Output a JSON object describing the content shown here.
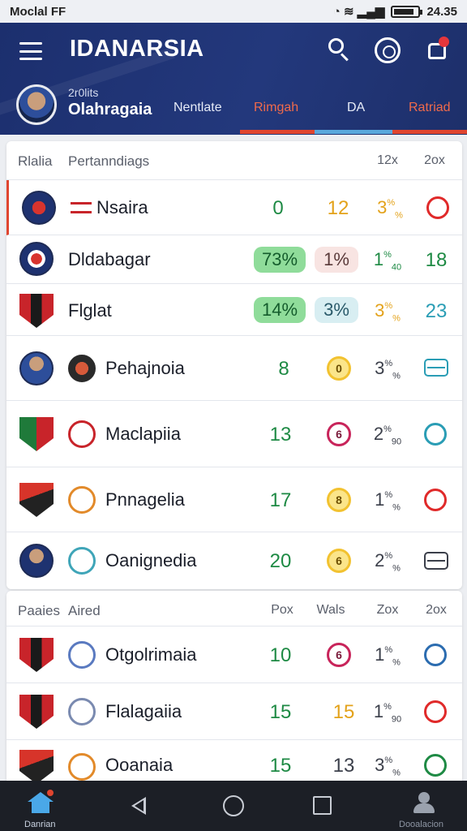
{
  "status_bar": {
    "left_text": "Moclal FF",
    "time": "24.35"
  },
  "header": {
    "app_title": "IDANARSIA",
    "league_label_small": "2r0lits",
    "league_name": "Olahragaia",
    "tabs": [
      {
        "label": "Nentlate",
        "active": false
      },
      {
        "label": "Rimgah",
        "active": true
      },
      {
        "label": "DA",
        "active": false
      },
      {
        "label": "Ratriad",
        "active": false
      }
    ],
    "colors": {
      "primary": "#1c2f6e",
      "accent_red": "#e0452f",
      "accent_blue": "#5aa8dc"
    }
  },
  "section1": {
    "header": {
      "left": "Rlalia",
      "title": "Pertanndiags",
      "col3": "12x",
      "col4": "2ox"
    },
    "rows": [
      {
        "name": "Nsaira",
        "v1": "0",
        "v2": "12",
        "v3_main": "3",
        "v3_sup": "%",
        "v3_sub": "%"
      },
      {
        "name": "Dldabagar",
        "v1": "73%",
        "v2": "1%",
        "v3_main": "1",
        "v3_sup": "%",
        "v3_sub": "40",
        "v4": "18"
      },
      {
        "name": "Flglat",
        "v1": "14%",
        "v2": "3%",
        "v3_main": "3",
        "v3_sup": "%",
        "v3_sub": "%",
        "v4": "23"
      },
      {
        "name": "Pehajnoia",
        "v1": "8",
        "coin": "0",
        "v3_main": "3",
        "v3_sup": "%",
        "v3_sub": "%"
      },
      {
        "name": "Maclapiia",
        "v1": "13",
        "coin": "6",
        "v3_main": "2",
        "v3_sup": "%",
        "v3_sub": "90"
      },
      {
        "name": "Pnnagelia",
        "v1": "17",
        "coin": "8",
        "v3_main": "1",
        "v3_sup": "%",
        "v3_sub": "%"
      },
      {
        "name": "Oanignedia",
        "v1": "20",
        "coin": "6",
        "v3_main": "2",
        "v3_sup": "%",
        "v3_sub": "%"
      }
    ]
  },
  "section2": {
    "header": {
      "left": "Paaies",
      "title": "Aired",
      "col1": "Pox",
      "col2": "Wals",
      "col3": "Zox",
      "col4": "2ox"
    },
    "rows": [
      {
        "name": "Otgolrimaia",
        "v1": "10",
        "coin": "6",
        "v3_main": "1",
        "v3_sup": "%",
        "v3_sub": "%"
      },
      {
        "name": "Flalagaiia",
        "v1": "15",
        "v2": "15",
        "v3_main": "1",
        "v3_sup": "%",
        "v3_sub": "90"
      },
      {
        "name": "Ooanaia",
        "v1": "15",
        "v2": "13",
        "v3_main": "3",
        "v3_sup": "%",
        "v3_sub": "%"
      }
    ]
  },
  "bottom_nav": {
    "home_label": "Danrian",
    "profile_label": "Dooalacion"
  }
}
